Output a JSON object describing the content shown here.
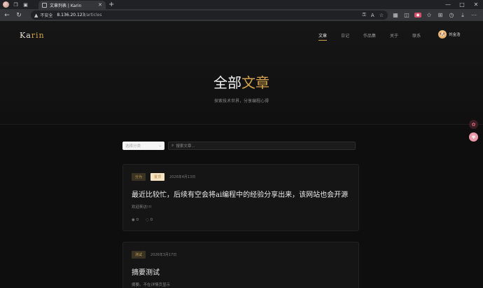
{
  "browser": {
    "tab_title": "文章列表 | Karin",
    "new_tab": "+",
    "security_label": "不安全",
    "url_host": "8.136.20.123",
    "url_path": "/articles",
    "win_min": "—",
    "win_max": "□",
    "win_close": "✕"
  },
  "site": {
    "logo_main": "Ka",
    "logo_accent": "rin",
    "nav": [
      "文章",
      "日记",
      "作品集",
      "关于",
      "联系"
    ],
    "user_name": "刘金浩",
    "hero_title_main": "全部",
    "hero_title_accent": "文章",
    "hero_subtitle": "探索技术世界，分享编程心得"
  },
  "filters": {
    "category_placeholder": "选择分类",
    "search_placeholder": "搜索文章..."
  },
  "articles": [
    {
      "category": "分为",
      "pinned": "置顶",
      "date": "2026年4月13日",
      "title": "最近比较忙，后续有空会将ai编程中的经验分享出来，该网站也会开源",
      "summary": "欢迎来访!!!",
      "views": "0",
      "comments": "0"
    },
    {
      "category": "测试",
      "date": "2026年3月17日",
      "title": "摘要测试",
      "summary": "摘要。不在详情页显示"
    }
  ],
  "colors": {
    "accent": "#d4a24a",
    "background": "#0e0e0e",
    "card": "#151515"
  }
}
